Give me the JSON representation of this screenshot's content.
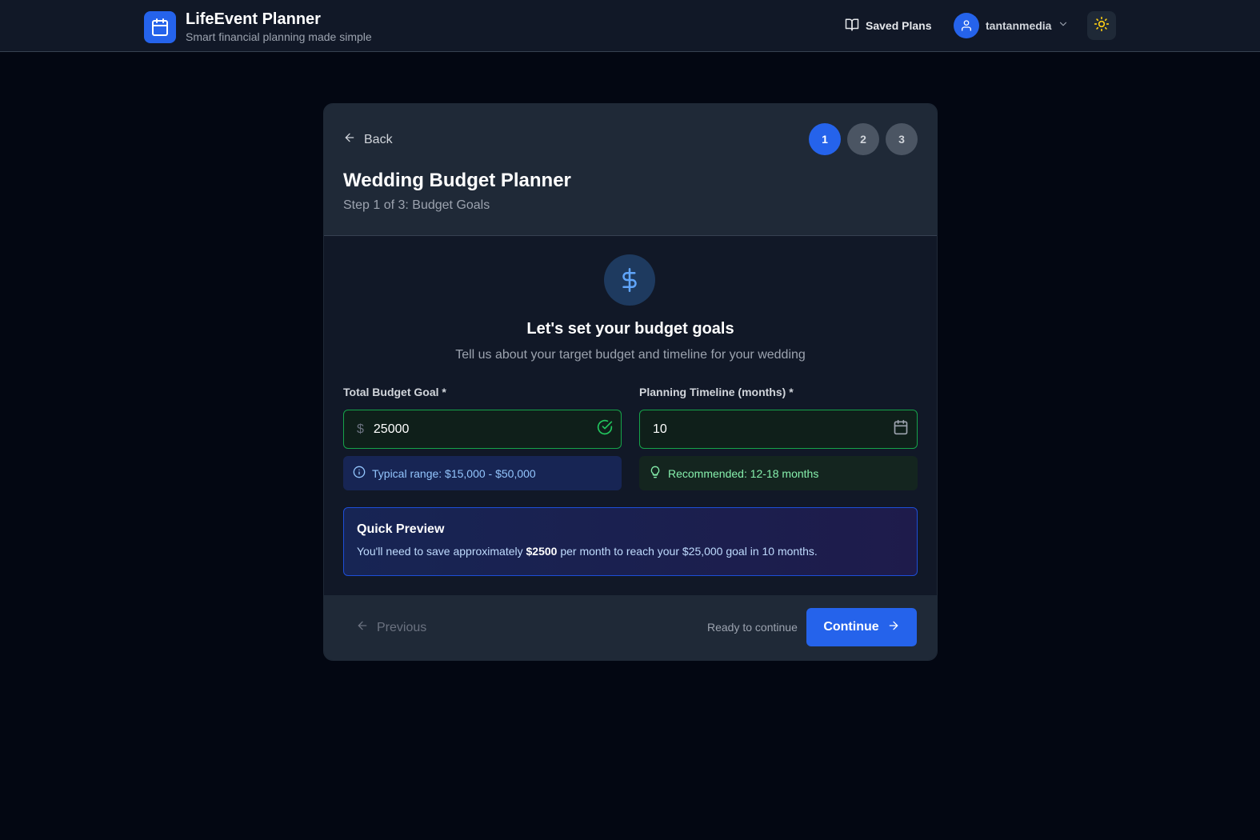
{
  "app": {
    "title": "LifeEvent Planner",
    "subtitle": "Smart financial planning made simple",
    "logo_icon": "calendar-icon"
  },
  "nav": {
    "saved_plans": "Saved Plans",
    "username": "tantanmedia"
  },
  "card": {
    "back": "Back",
    "steps": [
      "1",
      "2",
      "3"
    ],
    "active_step": 1,
    "title": "Wedding Budget Planner",
    "step_text": "Step 1 of 3: Budget Goals"
  },
  "hero": {
    "icon": "dollar-icon",
    "title": "Let's set your budget goals",
    "subtitle": "Tell us about your target budget and timeline for your wedding"
  },
  "fields": {
    "budget": {
      "label": "Total Budget Goal *",
      "prefix": "$",
      "value": "25000",
      "hint": "Typical range: $15,000 - $50,000"
    },
    "timeline": {
      "label": "Planning Timeline (months) *",
      "value": "10",
      "hint": "Recommended: 12-18 months"
    }
  },
  "preview": {
    "title": "Quick Preview",
    "text_before": "You'll need to save approximately ",
    "amount": "$2500",
    "text_after": " per month to reach your $25,000 goal in 10 months."
  },
  "footer": {
    "previous": "Previous",
    "ready": "Ready to continue",
    "continue": "Continue"
  },
  "colors": {
    "accent": "#2563eb",
    "success": "#16a34a",
    "background": "#030712"
  }
}
